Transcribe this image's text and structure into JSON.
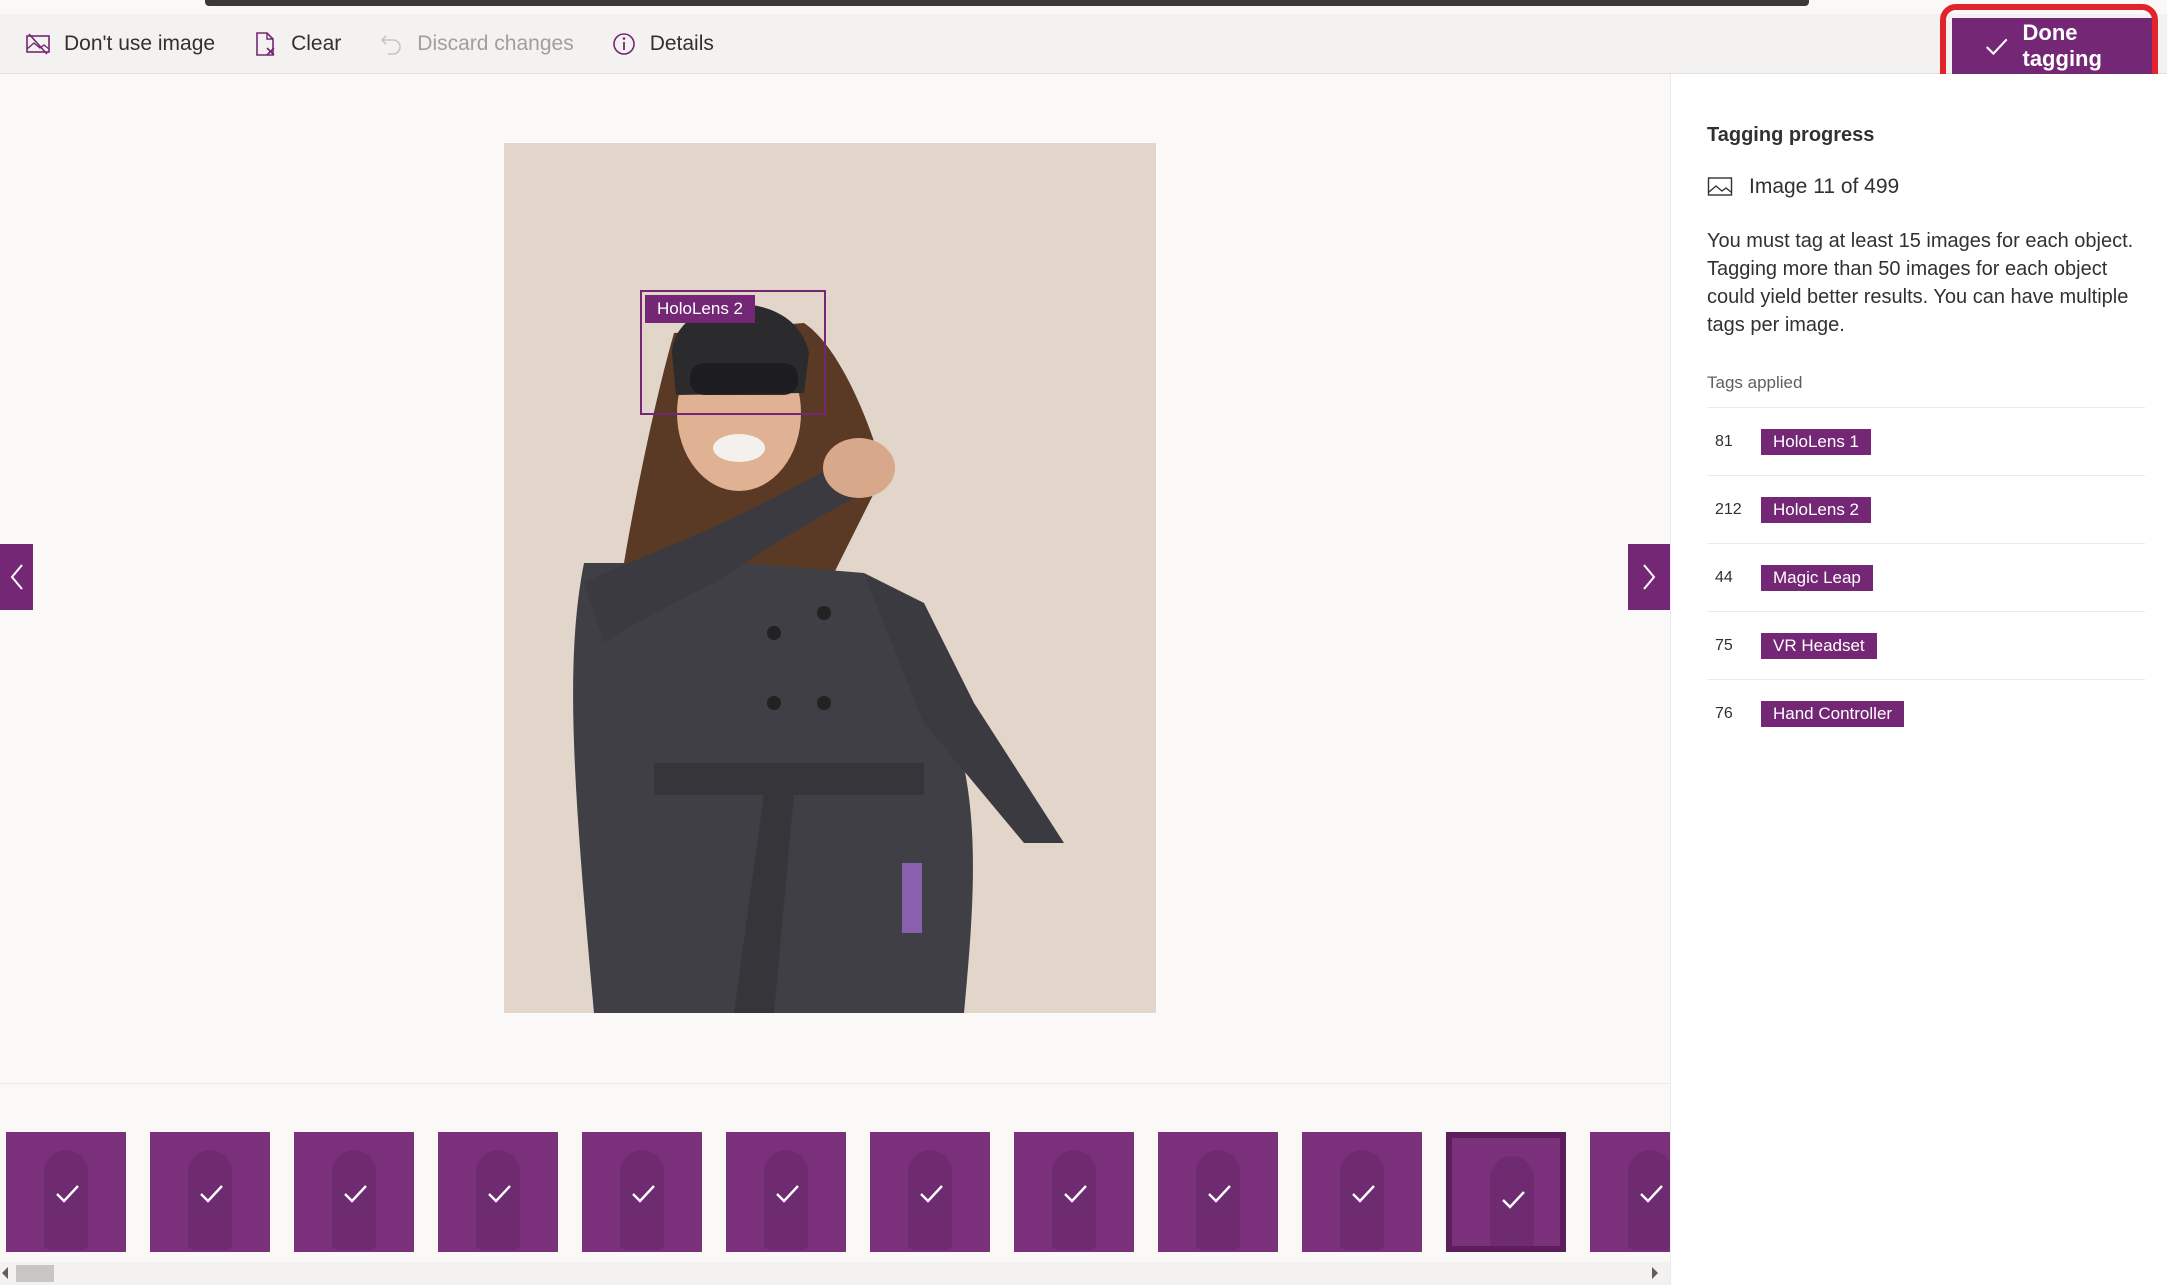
{
  "toolbar": {
    "dont_use": "Don't use image",
    "clear": "Clear",
    "discard": "Discard changes",
    "details": "Details",
    "done": "Done tagging"
  },
  "canvas": {
    "bbox_label": "HoloLens 2"
  },
  "thumbnails": {
    "count": 12,
    "selected_index": 10
  },
  "side": {
    "title": "Tagging progress",
    "progress": "Image 11 of 499",
    "help": "You must tag at least 15 images for each object. Tagging more than 50 images for each object could yield better results. You can have multiple tags per image.",
    "tags_title": "Tags applied",
    "tags": [
      {
        "count": "81",
        "name": "HoloLens 1"
      },
      {
        "count": "212",
        "name": "HoloLens 2"
      },
      {
        "count": "44",
        "name": "Magic Leap"
      },
      {
        "count": "75",
        "name": "VR Headset"
      },
      {
        "count": "76",
        "name": "Hand Controller"
      }
    ]
  },
  "colors": {
    "accent": "#742774",
    "highlight": "#e3232b"
  }
}
